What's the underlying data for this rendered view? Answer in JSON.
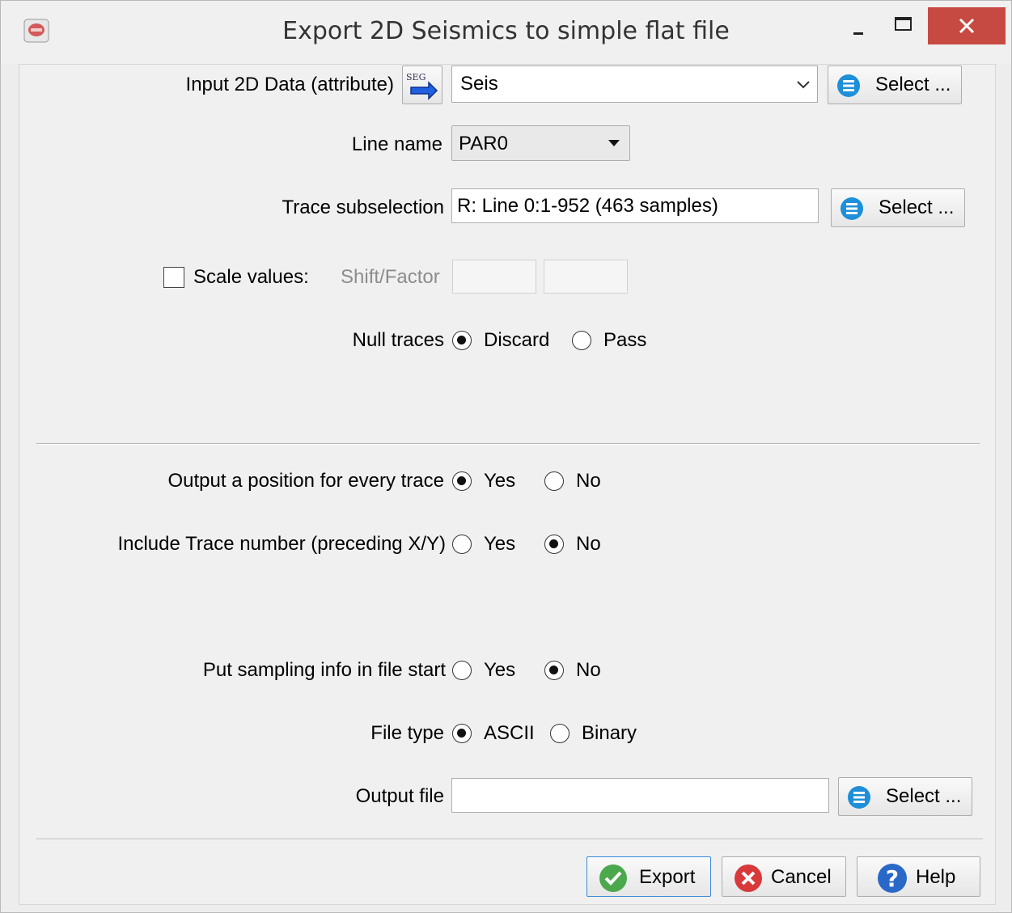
{
  "window": {
    "title": "Export 2D Seismics to simple flat file"
  },
  "input_data": {
    "label": "Input 2D Data (attribute)",
    "icon_text": "SEG",
    "value": "Seis",
    "select_label": "Select ..."
  },
  "line_name": {
    "label": "Line name",
    "value": "PAR0"
  },
  "trace_subselection": {
    "label": "Trace subselection",
    "value": "R: Line 0:1-952 (463 samples)",
    "select_label": "Select ..."
  },
  "scale": {
    "label": "Scale values:",
    "shift_factor_label": "Shift/Factor",
    "shift_value": "",
    "factor_value": "",
    "checked": false
  },
  "null_traces": {
    "label": "Null traces",
    "options": [
      "Discard",
      "Pass"
    ],
    "selected": "Discard"
  },
  "output_position": {
    "label": "Output a position for every trace",
    "options": [
      "Yes",
      "No"
    ],
    "selected": "Yes"
  },
  "include_trace_number": {
    "label": "Include Trace number (preceding X/Y)",
    "options": [
      "Yes",
      "No"
    ],
    "selected": "No"
  },
  "sampling_info": {
    "label": "Put sampling info in file start",
    "options": [
      "Yes",
      "No"
    ],
    "selected": "No"
  },
  "file_type": {
    "label": "File type",
    "options": [
      "ASCII",
      "Binary"
    ],
    "selected": "ASCII"
  },
  "output_file": {
    "label": "Output file",
    "value": "",
    "select_label": "Select ..."
  },
  "buttons": {
    "export": "Export",
    "cancel": "Cancel",
    "help": "Help"
  },
  "colors": {
    "close_button": "#c74a42",
    "select_icon": "#1e8fd8",
    "export_icon": "#4ca84c",
    "cancel_icon": "#d8393a",
    "help_icon": "#2a68c8"
  }
}
